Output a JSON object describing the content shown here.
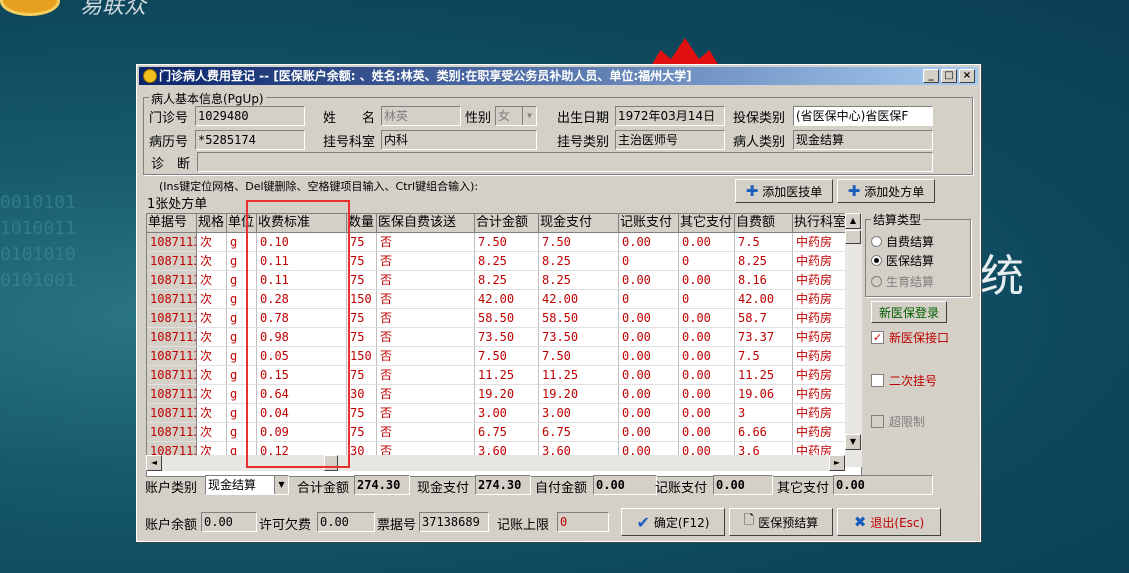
{
  "desktop": {
    "logo_text": "易联众",
    "background_char": "统",
    "background_digits": "0010101\n1010011\n0101010\n0101001"
  },
  "window": {
    "title": "门诊病人费用登记 -- [医保账户余额: 、姓名:林英、类别:在职享受公务员补助人员、单位:福州大学]",
    "min": "_",
    "max": "□",
    "close": "×"
  },
  "patient": {
    "group_title": "病人基本信息(PgUp)",
    "clinic_no_label": "门诊号",
    "clinic_no": "1029480",
    "name_label": "姓　　名",
    "name": "林英",
    "sex_label": "性别",
    "sex": "女",
    "birth_label": "出生日期",
    "birth": "1972年03月14日",
    "insure_type_label": "投保类别",
    "insure_type": "(省医保中心)省医保F",
    "record_no_label": "病历号",
    "record_no": "*5285174",
    "dept_label": "挂号科室",
    "dept": "内科",
    "reg_type_label": "挂号类别",
    "reg_type": "主治医师号",
    "patient_type_label": "病人类别",
    "patient_type": "现金结算",
    "diagnosis_label": "诊　断",
    "diagnosis": ""
  },
  "hint": "(Ins键定位网格、Del键删除、空格键项目输入、Ctrl键组合输入):",
  "prescription_count": "1张处方单",
  "buttons": {
    "add_tech": "添加医技单",
    "add_rx": "添加处方单",
    "confirm": "确定(F12)",
    "preview": "医保预结算",
    "exit": "退出(Esc)",
    "new_login": "新医保登录"
  },
  "table": {
    "headers": [
      "单据号",
      "规格",
      "单位",
      "收费标准",
      "数量",
      "医保自费该送",
      "合计金额",
      "现金支付",
      "记账支付",
      "其它支付",
      "自费额",
      "执行科室"
    ],
    "rows": [
      [
        "1087113",
        "次",
        "g",
        "0.10",
        "75",
        "否",
        "7.50",
        "7.50",
        "0.00",
        "0.00",
        "7.5",
        "中药房"
      ],
      [
        "1087113",
        "次",
        "g",
        "0.11",
        "75",
        "否",
        "8.25",
        "8.25",
        "0",
        "0",
        "8.25",
        "中药房"
      ],
      [
        "1087113",
        "次",
        "g",
        "0.11",
        "75",
        "否",
        "8.25",
        "8.25",
        "0.00",
        "0.00",
        "8.16",
        "中药房"
      ],
      [
        "1087113",
        "次",
        "g",
        "0.28",
        "150",
        "否",
        "42.00",
        "42.00",
        "0",
        "0",
        "42.00",
        "中药房"
      ],
      [
        "1087113",
        "次",
        "g",
        "0.78",
        "75",
        "否",
        "58.50",
        "58.50",
        "0.00",
        "0.00",
        "58.7",
        "中药房"
      ],
      [
        "1087113",
        "次",
        "g",
        "0.98",
        "75",
        "否",
        "73.50",
        "73.50",
        "0.00",
        "0.00",
        "73.37",
        "中药房"
      ],
      [
        "1087113",
        "次",
        "g",
        "0.05",
        "150",
        "否",
        "7.50",
        "7.50",
        "0.00",
        "0.00",
        "7.5",
        "中药房"
      ],
      [
        "1087113",
        "次",
        "g",
        "0.15",
        "75",
        "否",
        "11.25",
        "11.25",
        "0.00",
        "0.00",
        "11.25",
        "中药房"
      ],
      [
        "1087113",
        "次",
        "g",
        "0.64",
        "30",
        "否",
        "19.20",
        "19.20",
        "0.00",
        "0.00",
        "19.06",
        "中药房"
      ],
      [
        "1087113",
        "次",
        "g",
        "0.04",
        "75",
        "否",
        "3.00",
        "3.00",
        "0.00",
        "0.00",
        "3",
        "中药房"
      ],
      [
        "1087113",
        "次",
        "g",
        "0.09",
        "75",
        "否",
        "6.75",
        "6.75",
        "0.00",
        "0.00",
        "6.66",
        "中药房"
      ],
      [
        "1087113",
        "次",
        "g",
        "0.12",
        "30",
        "否",
        "3.60",
        "3.60",
        "0.00",
        "0.00",
        "3.6",
        "中药房"
      ]
    ]
  },
  "settle": {
    "group_title": "结算类型",
    "self": "自费结算",
    "insured": "医保结算",
    "birth": "生育结算",
    "selected": "insured"
  },
  "checks": {
    "new_port": "新医保接口",
    "second_reg": "二次挂号",
    "over_limit": "超限制"
  },
  "footer": {
    "account_type_label": "账户类别",
    "account_type": "现金结算",
    "total_label": "合计金额",
    "total": "274.30",
    "cash_label": "现金支付",
    "cash": "274.30",
    "selfpay_label": "自付金额",
    "selfpay": "0.00",
    "charge_label": "记账支付",
    "charge": "0.00",
    "other_label": "其它支付",
    "other": "0.00",
    "balance_label": "账户余额",
    "balance": "0.00",
    "allow_owe_label": "许可欠费",
    "allow_owe": "0.00",
    "receipt_label": "票据号",
    "receipt": "37138689",
    "limit_label": "记账上限",
    "limit": "0"
  }
}
